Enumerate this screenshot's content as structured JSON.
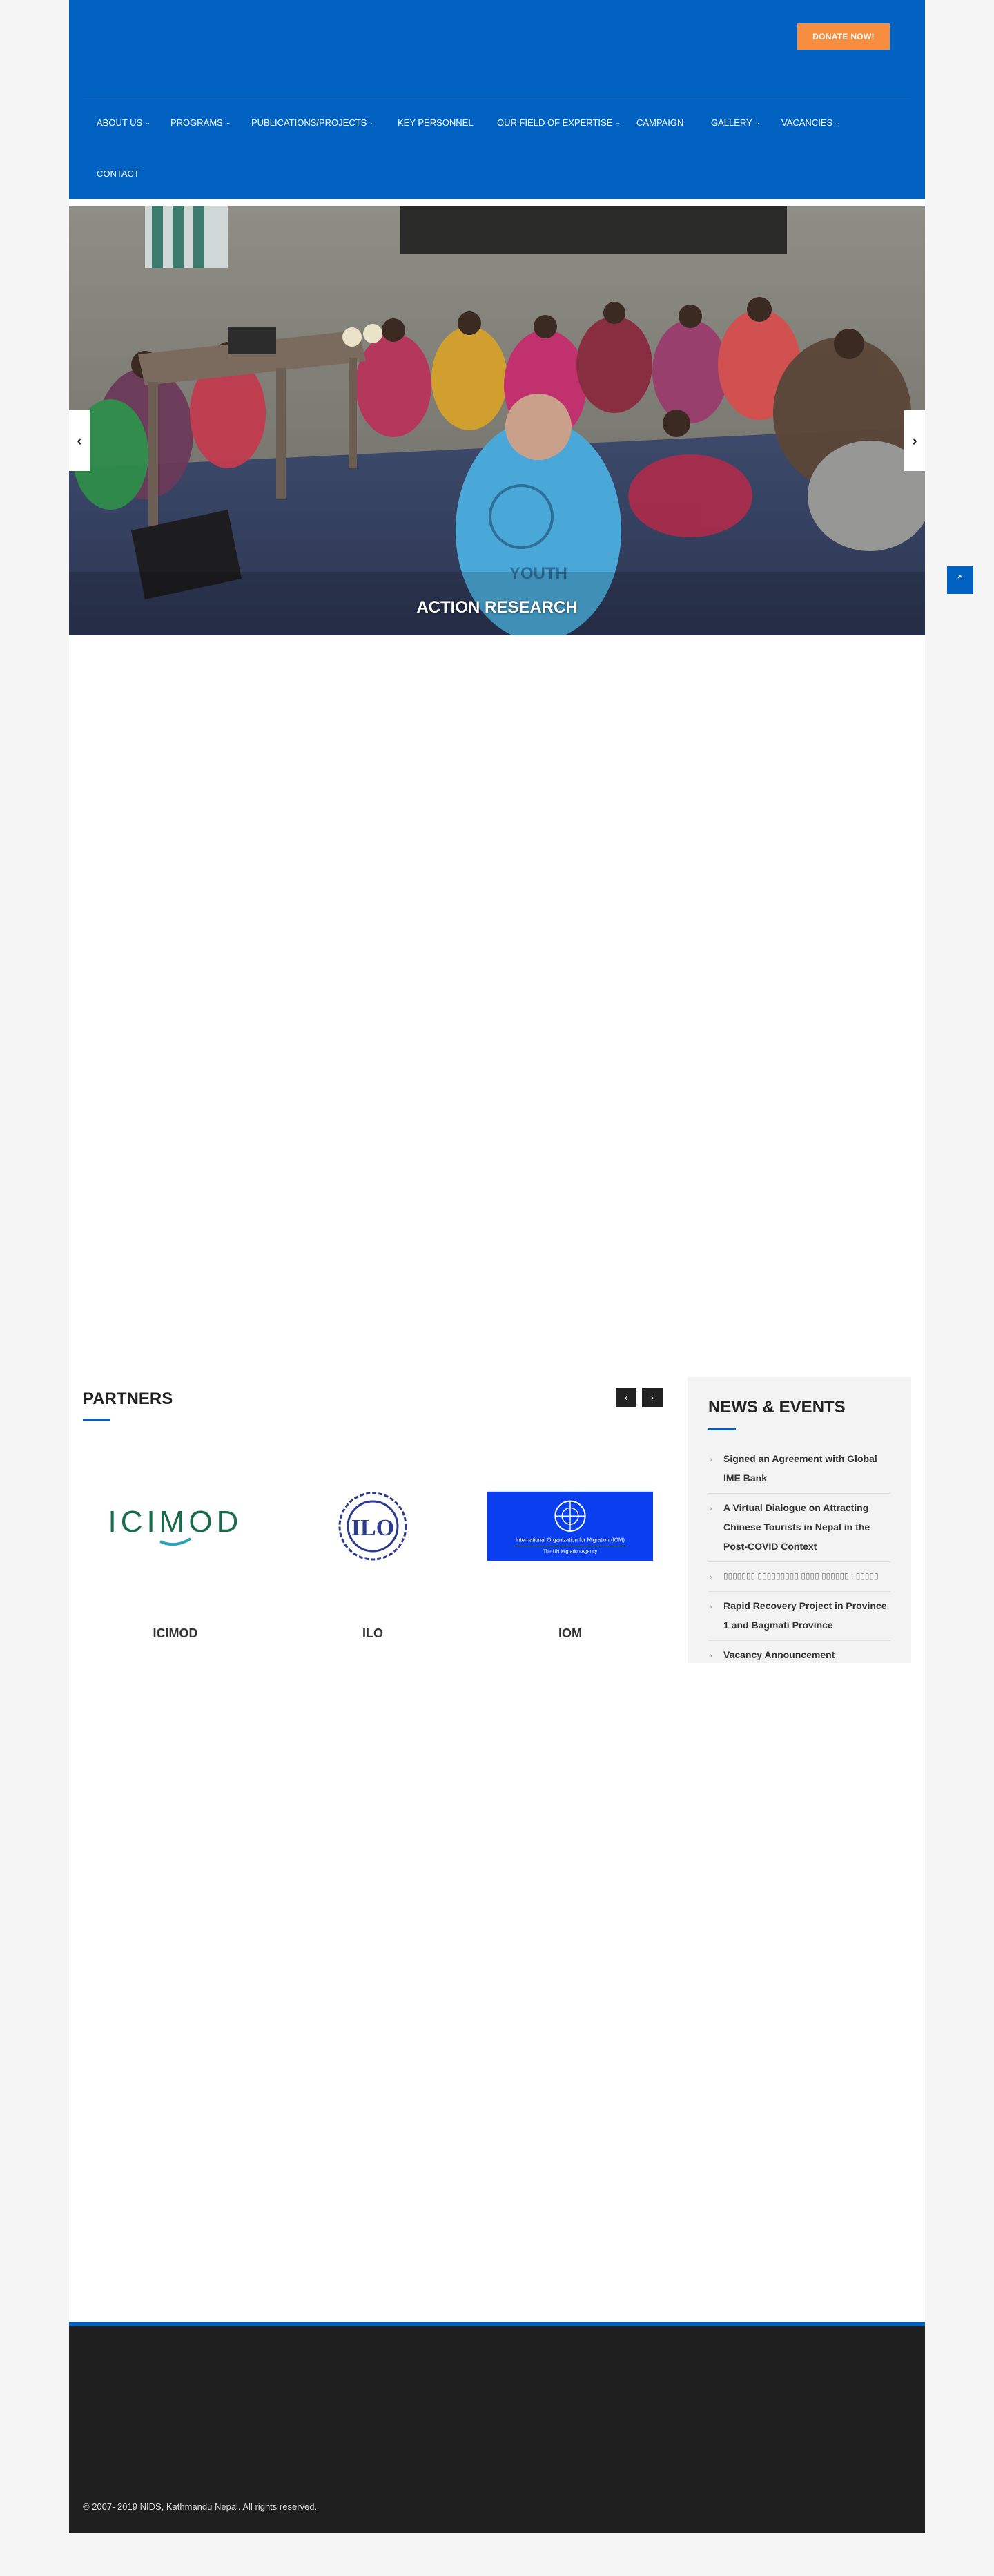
{
  "header": {
    "donate_label": "DONATE NOW!",
    "nav": [
      {
        "label": "ABOUT US",
        "has_dropdown": true
      },
      {
        "label": "PROGRAMS",
        "has_dropdown": true
      },
      {
        "label": "PUBLICATIONS/PROJECTS",
        "has_dropdown": true
      },
      {
        "label": "KEY PERSONNEL",
        "has_dropdown": false
      },
      {
        "label": "OUR FIELD OF EXPERTISE",
        "has_dropdown": true
      },
      {
        "label": "CAMPAIGN",
        "has_dropdown": false
      },
      {
        "label": "GALLERY",
        "has_dropdown": true
      },
      {
        "label": "VACANCIES",
        "has_dropdown": true
      },
      {
        "label": "CONTACT",
        "has_dropdown": false
      }
    ],
    "colors": {
      "brand": "#0262c2",
      "donate": "#f78d3f"
    }
  },
  "slider": {
    "caption": "ACTION RESEARCH",
    "prev_icon": "chevron-left-icon",
    "next_icon": "chevron-right-icon"
  },
  "back_to_top_icon": "chevron-up-icon",
  "partners": {
    "title": "PARTNERS",
    "items": [
      {
        "name": "ICIMOD",
        "logo_text": "ICIMOD"
      },
      {
        "name": "ILO",
        "logo_text": "ILO"
      },
      {
        "name": "IOM",
        "logo_text": "International Organization for Migration (IOM)",
        "logo_subtext": "The UN Migration Agency"
      }
    ]
  },
  "news": {
    "title": "NEWS & EVENTS",
    "items": [
      "Signed an Agreement with Global IME Bank",
      "A Virtual Dialogue on Attracting Chinese Tourists in Nepal in the Post-COVID Context",
      "▯▯▯▯▯▯▯ ▯▯▯▯▯▯▯▯▯ ▯▯▯▯ ▯▯▯▯▯▯ : ▯▯▯▯▯",
      "Rapid Recovery Project in Province 1 and Bagmati Province",
      "Vacancy Announcement"
    ]
  },
  "footer": {
    "copyright": "© 2007- 2019 NIDS, Kathmandu Nepal. All rights reserved."
  }
}
